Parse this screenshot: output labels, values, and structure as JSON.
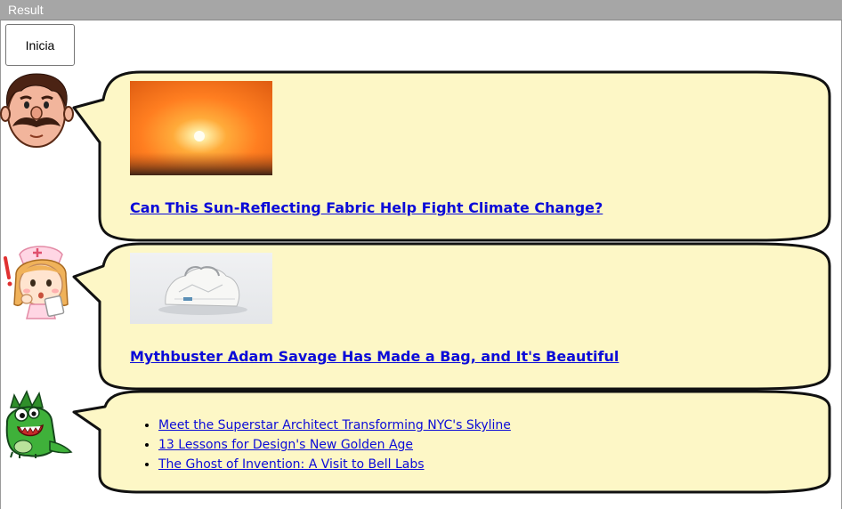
{
  "window": {
    "title": "Result"
  },
  "toolbar": {
    "start_button_label": "Inicia"
  },
  "messages": [
    {
      "avatar": "mustached-man-icon",
      "image_desc_icon": "sunset-thumbnail",
      "link_text": "Can This Sun-Reflecting Fabric Help Fight Climate Change?"
    },
    {
      "avatar": "nurse-girl-icon",
      "image_desc_icon": "white-bag-thumbnail",
      "link_text": "Mythbuster Adam Savage Has Made a Bag, and It's Beautiful"
    },
    {
      "avatar": "green-monster-icon",
      "links": [
        "Meet the Superstar Architect Transforming NYC's Skyline",
        "13 Lessons for Design's New Golden Age",
        "The Ghost of Invention: A Visit to Bell Labs"
      ]
    }
  ],
  "colors": {
    "bubble_fill": "#fdf7c6",
    "bubble_stroke": "#111111",
    "link": "#0b0bd8",
    "header_bg": "#a6a6a6"
  }
}
